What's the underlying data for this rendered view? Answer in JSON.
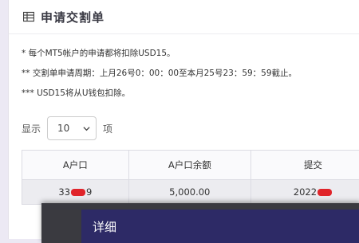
{
  "card": {
    "title": "申请交割单",
    "icon": "table-icon"
  },
  "notes": [
    "* 每个MT5帐户的申请都将扣除USD15。",
    "** 交割单申请周期：上月26号0：00：00至本月25号23：59：59截止。",
    "*** USD15将从U钱包扣除。"
  ],
  "length_menu": {
    "show_label": "显示",
    "selected": "10",
    "items_label": "项"
  },
  "table": {
    "headers": [
      "A户口",
      "A户口余额",
      "提交"
    ],
    "rows": [
      {
        "account_prefix": "33",
        "account_suffix": "9",
        "balance": "5,000.00",
        "date_prefix": "2022"
      }
    ]
  },
  "modal": {
    "title": "详细"
  },
  "colors": {
    "background": "#ece9f4",
    "modal_header": "#2d2a66",
    "redaction": "#e0242a"
  }
}
